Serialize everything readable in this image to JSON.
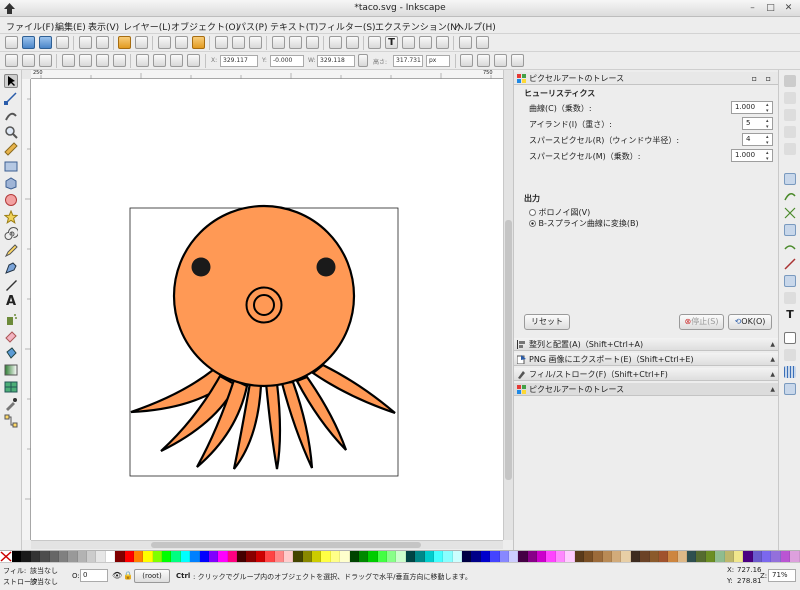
{
  "window": {
    "title": "*taco.svg - Inkscape"
  },
  "menu": [
    "ファイル(F)",
    "編集(E)",
    "表示(V)",
    "レイヤー(L)",
    "オブジェクト(O)",
    "パス(P)",
    "テキスト(T)",
    "フィルター(S)",
    "エクステンション(N)",
    "ヘルプ(H)"
  ],
  "controls": {
    "x_label": "X:",
    "x_value": "329.117",
    "y_label": "Y:",
    "y_value": "-0.000",
    "w_label": "W:",
    "w_value": "329.118",
    "h_label": "高さ:",
    "h_value": "317.731",
    "unit": "px"
  },
  "ruler": {
    "h_start": "250",
    "h_end": "750"
  },
  "dock": {
    "panel_title": "ピクセルアートのトレース",
    "heuristics_heading": "ヒューリスティクス",
    "fields": [
      {
        "label": "曲線(C)（乗数）:",
        "value": "1.000"
      },
      {
        "label": "アイランド(I)（重さ）:",
        "value": "5"
      },
      {
        "label": "スパースピクセル(R)（ウィンドウ半径）:",
        "value": "4"
      },
      {
        "label": "スパースピクセル(M)（乗数）:",
        "value": "1.000"
      }
    ],
    "output_heading": "出力",
    "radios": [
      {
        "label": "ボロノイ図(V)",
        "checked": false
      },
      {
        "label": "B-スプライン曲線に変換(B)",
        "checked": true
      }
    ],
    "reset_button": "リセット",
    "stop_button": "停止(S)",
    "ok_button": "OK(O)",
    "collapsed_panels": [
      "整列と配置(A)（Shift+Ctrl+A)",
      "PNG 画像にエクスポート(E)（Shift+Ctrl+E)",
      "フィル/ストローク(F)（Shift+Ctrl+F)",
      "ピクセルアートのトレース"
    ]
  },
  "status": {
    "fill_label": "フィル:",
    "fill_value": "該当なし",
    "stroke_label": "ストローク:",
    "stroke_value": "該当なし",
    "opacity_label": "O:",
    "opacity_value": "0",
    "layer": "(root)",
    "message_key": "Ctrl",
    "message": ": クリックでグループ内のオブジェクトを選択、ドラッグで水平/垂直方向に移動します。",
    "x_label": "X:",
    "x_coord": "727.16",
    "y_label": "Y:",
    "y_coord": "278.81",
    "zoom_label": "Z:",
    "zoom": "71%"
  },
  "colors": {
    "octopus_fill": "#ff9955",
    "outline": "#000000",
    "eye": "#1a1a1a"
  }
}
